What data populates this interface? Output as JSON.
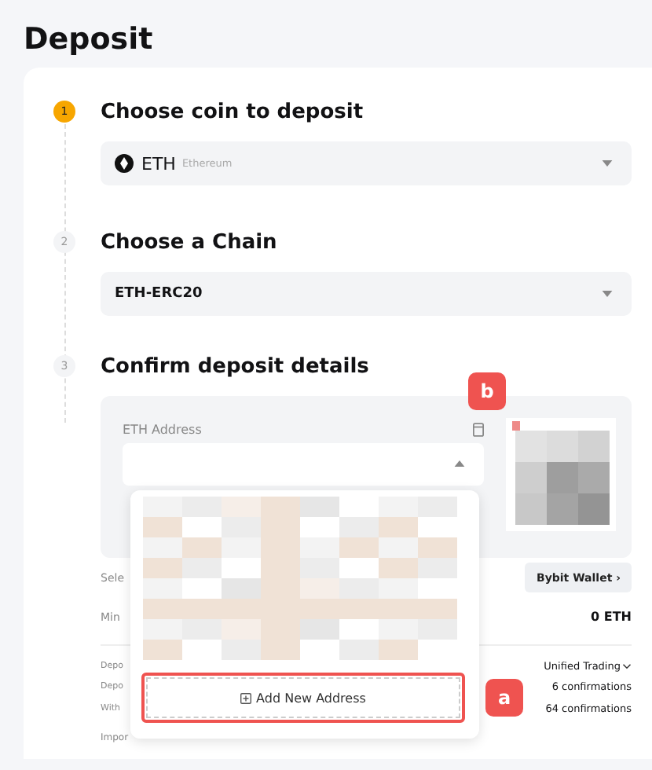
{
  "title": "Deposit",
  "steps": [
    {
      "number": "1",
      "title": "Choose coin to deposit",
      "selected": true
    },
    {
      "number": "2",
      "title": "Choose a Chain",
      "selected": false
    },
    {
      "number": "3",
      "title": "Confirm deposit details",
      "selected": false
    }
  ],
  "coin_select": {
    "symbol": "ETH",
    "name": "Ethereum"
  },
  "chain_select": {
    "value": "ETH-ERC20"
  },
  "address": {
    "label": "ETH Address"
  },
  "address_dropdown": {
    "expanded": true,
    "add_button": "Add New Address"
  },
  "annotations": [
    "a",
    "b"
  ],
  "details": [
    {
      "label": "Sele",
      "value": "Bybit Wallet ›",
      "kind": "button"
    },
    {
      "label": "Min",
      "value": "0 ETH",
      "kind": "text"
    }
  ],
  "info": [
    {
      "label": "Depo",
      "value": "Unified Trading",
      "kind": "dropdown"
    },
    {
      "label": "Depo",
      "value": "6 confirmations",
      "kind": "text"
    },
    {
      "label": "With",
      "value": "64 confirmations",
      "kind": "text"
    }
  ],
  "footer": "Impor"
}
